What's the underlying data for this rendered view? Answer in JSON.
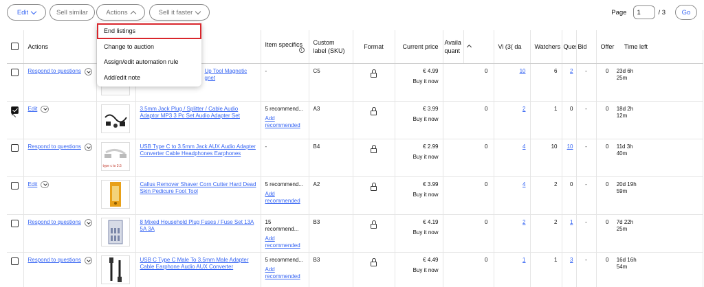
{
  "toolbar": {
    "edit_label": "Edit",
    "sell_similar_label": "Sell similar",
    "actions_label": "Actions",
    "sell_faster_label": "Sell it faster"
  },
  "pager": {
    "label": "Page",
    "current": "1",
    "total": "/ 3",
    "go_label": "Go"
  },
  "actions_menu": {
    "items": [
      "End listings",
      "Change to auction",
      "Assign/edit automation rule",
      "Add/edit note"
    ],
    "highlight_color": "#d9262c"
  },
  "table": {
    "headers": {
      "actions": "Actions",
      "item_specifics": "Item specifics",
      "custom_label": "Custom label (SKU)",
      "format": "Format",
      "current_price": "Current price",
      "available_quantity": "Availa quant",
      "views": "Vi (3( da",
      "watchers": "Watchers",
      "questions": "Questic",
      "bids": "Bid",
      "offers": "Offer",
      "time_left": "Time left"
    },
    "rows": [
      {
        "action": "Respond to questions",
        "checked": false,
        "title_a": "Up Tool Magnetic",
        "title_b": "gnet",
        "specifics": "-",
        "specifics_link": "",
        "sku": "C5",
        "price": "€ 4.99",
        "format_text": "Buy it now",
        "available": "0",
        "views": "10",
        "watchers": "6",
        "questions": "2",
        "bids": "-",
        "offers": "0",
        "time_left": "23d 6h 25m"
      },
      {
        "action": "Edit",
        "checked": true,
        "title_a": "3.5mm Jack Plug / Splitter / Cable Audio",
        "title_b": "Adaptor MP3 3 Pc Set Audio Adapter Set",
        "specifics": "5 recommend...",
        "specifics_link": "Add recommended",
        "sku": "A3",
        "price": "€ 3.99",
        "format_text": "Buy it now",
        "available": "0",
        "views": "2",
        "watchers": "1",
        "questions": "0",
        "bids": "-",
        "offers": "0",
        "time_left": "18d 2h 12m"
      },
      {
        "action": "Respond to questions",
        "checked": false,
        "title_a": "USB Type C to 3.5mm Jack AUX Audio Adapter",
        "title_b": "Converter Cable Headphones Earphones",
        "specifics": "-",
        "specifics_link": "",
        "sku": "B4",
        "price": "€ 2.99",
        "format_text": "Buy it now",
        "available": "0",
        "views": "4",
        "watchers": "10",
        "questions": "10",
        "bids": "-",
        "offers": "0",
        "time_left": "11d 3h 40m"
      },
      {
        "action": "Edit",
        "checked": false,
        "title_a": "Callus Remover Shaver Corn Cutter Hard Dead",
        "title_b": "Skin Pedicure Foot Tool",
        "specifics": "5 recommend...",
        "specifics_link": "Add recommended",
        "sku": "A2",
        "price": "€ 3.99",
        "format_text": "Buy it now",
        "available": "0",
        "views": "4",
        "watchers": "2",
        "questions": "0",
        "bids": "-",
        "offers": "0",
        "time_left": "20d 19h 59m"
      },
      {
        "action": "Respond to questions",
        "checked": false,
        "title_a": "8 Mixed Household Plug Fuses / Fuse Set 13A",
        "title_b": "5A 3A",
        "specifics": "15 recommend...",
        "specifics_link": "Add recommended",
        "sku": "B3",
        "price": "€ 4.19",
        "format_text": "Buy it now",
        "available": "0",
        "views": "2",
        "watchers": "2",
        "questions": "1",
        "bids": "-",
        "offers": "0",
        "time_left": "7d 22h 25m"
      },
      {
        "action": "Respond to questions",
        "checked": false,
        "title_a": "USB C Type C Male To 3.5mm Male Adapter",
        "title_b": "Cable Earphone Audio AUX Converter",
        "specifics": "5 recommend...",
        "specifics_link": "Add recommended",
        "sku": "B3",
        "price": "€ 4.49",
        "format_text": "Buy it now",
        "available": "0",
        "views": "1",
        "watchers": "1",
        "questions": "3",
        "bids": "-",
        "offers": "0",
        "time_left": "16d 16h 54m"
      }
    ],
    "thumb_caption_row3": "type c to 3.5"
  },
  "colors": {
    "link": "#3665f3",
    "border": "#e5e5e5",
    "menu_highlight": "#d9262c"
  }
}
